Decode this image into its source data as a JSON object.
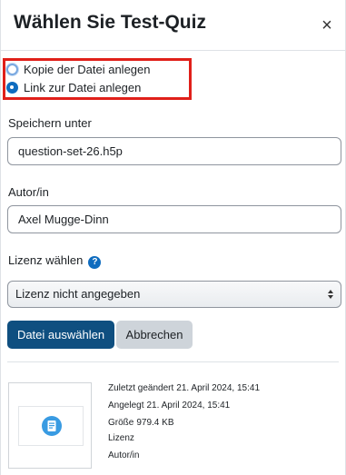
{
  "dialog": {
    "title": "Wählen Sie Test-Quiz",
    "close_symbol": "×"
  },
  "options": {
    "copy_label": "Kopie der Datei anlegen",
    "link_label": "Link zur Datei anlegen",
    "selected": "link"
  },
  "save_as": {
    "label": "Speichern unter",
    "value": "question-set-26.h5p"
  },
  "author": {
    "label": "Autor/in",
    "value": "Axel Mugge-Dinn"
  },
  "license": {
    "label": "Lizenz wählen",
    "help_symbol": "?",
    "selected": "Lizenz nicht angegeben"
  },
  "buttons": {
    "select_file": "Datei auswählen",
    "cancel": "Abbrechen"
  },
  "file_info": {
    "modified_label": "Zuletzt geändert",
    "modified_value": "21. April 2024, 15:41",
    "created_label": "Angelegt",
    "created_value": "21. April 2024, 15:41",
    "size_label": "Größe",
    "size_value": "979.4 KB",
    "license_label": "Lizenz",
    "author_label": "Autor/in"
  },
  "colors": {
    "primary": "#0f4f80",
    "highlight_border": "#e0201a",
    "file_icon": "#399be2"
  },
  "icons": {
    "close": "close-icon",
    "help": "help-icon",
    "select_arrows": "select-arrows-icon",
    "file_type": "h5p-file-icon"
  }
}
